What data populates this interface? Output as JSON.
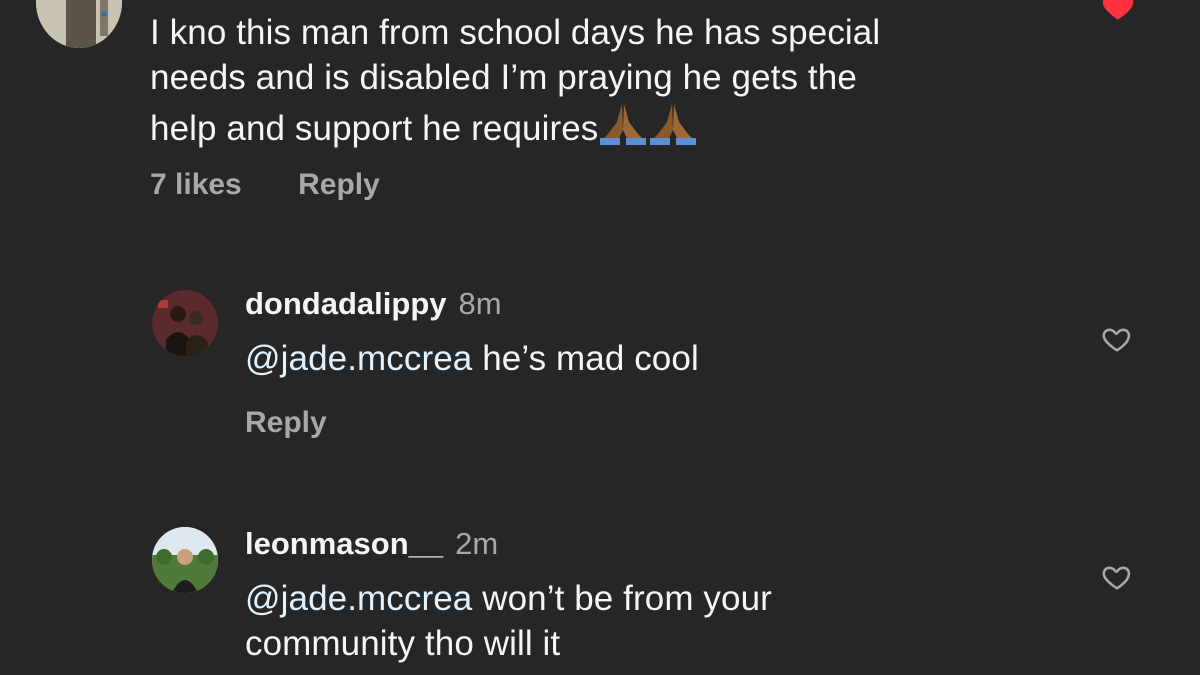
{
  "top_comment": {
    "text_lines": [
      "I kno this man from school days he has special",
      "needs and is disabled I’m praying he gets the",
      "help and support he requires"
    ],
    "emoji": [
      "folded-hands-emoji",
      "folded-hands-emoji"
    ],
    "likes_label": "7 likes",
    "reply_label": "Reply",
    "liked": true,
    "liked_color": "#ff3040"
  },
  "replies": [
    {
      "username": "dondadalippy",
      "time": "8m",
      "mention": "@jade.mccrea",
      "text_lines": [
        " he’s mad cool"
      ],
      "reply_label": "Reply",
      "liked": false
    },
    {
      "username": "leonmason__",
      "time": "2m",
      "mention": "@jade.mccrea",
      "text_lines": [
        " won’t be from your",
        "community tho will it"
      ],
      "liked": false
    }
  ],
  "colors": {
    "background": "#262626",
    "primary_text": "#f5f5f5",
    "secondary_text": "#a8a8a8",
    "mention": "#e0f1ff"
  }
}
